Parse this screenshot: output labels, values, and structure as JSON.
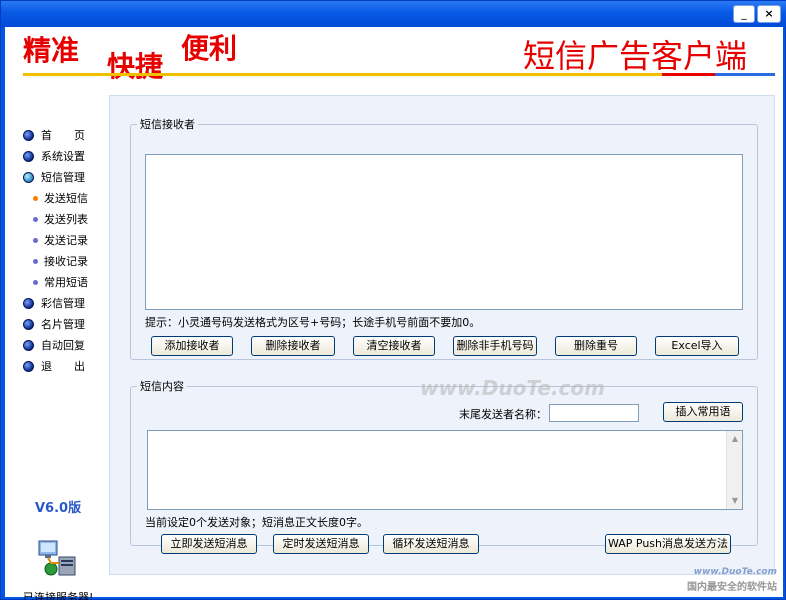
{
  "window": {
    "minimize": "_",
    "close": "×"
  },
  "header": {
    "slogan1": "精准",
    "slogan2": "快捷",
    "slogan3": "便利",
    "app_title": "短信广告客户端"
  },
  "sidebar": {
    "items": [
      {
        "label": "首　　页"
      },
      {
        "label": "系统设置"
      },
      {
        "label": "短信管理"
      }
    ],
    "subitems": [
      {
        "label": "发送短信"
      },
      {
        "label": "发送列表"
      },
      {
        "label": "发送记录"
      },
      {
        "label": "接收记录"
      },
      {
        "label": "常用短语"
      }
    ],
    "items2": [
      {
        "label": "彩信管理"
      },
      {
        "label": "名片管理"
      },
      {
        "label": "自动回复"
      },
      {
        "label": "退　　出"
      }
    ],
    "version": "V6.0版",
    "server_status": "已连接服务器!"
  },
  "recipients": {
    "legend": "短信接收者",
    "hint": "提示：小灵通号码发送格式为区号+号码；长途手机号前面不要加0。",
    "buttons": {
      "add": "添加接收者",
      "delete": "删除接收者",
      "clear": "清空接收者",
      "delete_non_mobile": "删除非手机号码",
      "delete_dup": "删除重号",
      "excel_import": "Excel导入"
    }
  },
  "message": {
    "legend": "短信内容",
    "sender_label": "末尾发送者名称：",
    "sender_value": "",
    "insert_phrase": "插入常用语",
    "status": "当前设定0个发送对象；短消息正文长度0字。",
    "buttons": {
      "send_now": "立即发送短消息",
      "send_timed": "定时发送短消息",
      "send_loop": "循环发送短消息",
      "wap_push": "WAP Push消息发送方法"
    }
  },
  "watermark": {
    "center": "www.DuoTe.com",
    "corner_url": "www.DuoTe.com",
    "corner_text": "国内最安全的软件站"
  }
}
